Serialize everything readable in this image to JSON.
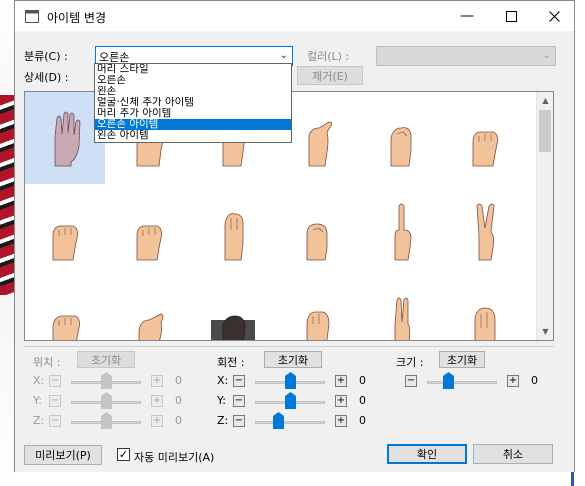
{
  "window": {
    "title": "아이템 변경"
  },
  "category": {
    "label": "분류(C) :",
    "value": "오른손"
  },
  "color": {
    "label": "컬러(L) :"
  },
  "detail": {
    "label": "상세(D) :"
  },
  "remove_button": "제거(E)",
  "dropdown": {
    "items": [
      "머리 스타일",
      "오른손",
      "왼손",
      "얼굴·신체 추가 아이템",
      "머리 추가 아이템",
      "오른손 아이템",
      "왼손 아이템"
    ],
    "selected_index": 5
  },
  "position": {
    "label": "위치 :",
    "reset": "초기화",
    "rows": [
      {
        "axis": "X:",
        "value": "0",
        "level": 0.5
      },
      {
        "axis": "Y:",
        "value": "0",
        "level": 0.5
      },
      {
        "axis": "Z:",
        "value": "0",
        "level": 0.5
      }
    ]
  },
  "rotation": {
    "label": "회전 :",
    "reset": "초기화",
    "rows": [
      {
        "axis": "X:",
        "value": "0",
        "level": 0.5
      },
      {
        "axis": "Y:",
        "value": "0",
        "level": 0.5
      },
      {
        "axis": "Z:",
        "value": "0",
        "level": 0.33
      }
    ]
  },
  "size": {
    "label": "크기 :",
    "reset": "초기화",
    "value": "0",
    "level": 0.3
  },
  "preview_button": "미리보기(P)",
  "auto_preview": {
    "label": "자동 미리보기(A)",
    "checked": true
  },
  "ok_button": "확인",
  "cancel_button": "취소",
  "hand_cells": [
    "open-palm",
    "closed-fist",
    "relaxed-hand",
    "pointing-hand",
    "curled-hand",
    "fist",
    "fist",
    "fist",
    "upright-fist",
    "relaxed-fist",
    "index-finger-up",
    "peace-sign",
    "closed-fist",
    "pinch",
    "dark-hand",
    "relaxed-hand",
    "two-fingers",
    "palm-up"
  ],
  "colors": {
    "accent": "#0078d7",
    "selection_bg": "#cfe0f6",
    "skin": "#f2c29a"
  }
}
